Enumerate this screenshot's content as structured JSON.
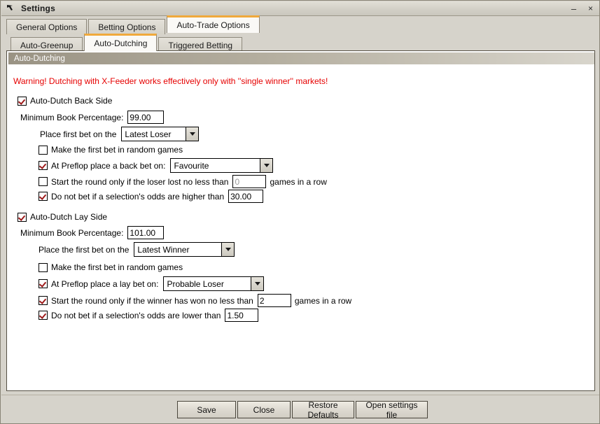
{
  "window": {
    "title": "Settings",
    "icon": "app-arrow-icon",
    "minimize_label": "–",
    "close_label": "×"
  },
  "colors": {
    "warning_text": "#e60000",
    "active_tab_accent": "#f0a93c",
    "dialog_background": "#d6d3cb",
    "panel_background": "#ffffff",
    "checkmark": "#9e1b1b",
    "group_header_text": "#ffffff",
    "disabled_text": "#9a9a9a"
  },
  "tabs_primary": [
    {
      "label": "General Options",
      "active": false
    },
    {
      "label": "Betting Options",
      "active": false
    },
    {
      "label": "Auto-Trade Options",
      "active": true
    }
  ],
  "tabs_secondary": [
    {
      "label": "Auto-Greenup",
      "active": false
    },
    {
      "label": "Auto-Dutching",
      "active": true
    },
    {
      "label": "Triggered Betting",
      "active": false
    }
  ],
  "panel": {
    "group_header": "Auto-Dutching",
    "warning": "Warning! Dutching with X-Feeder works effectively only with ''single winner'' markets!"
  },
  "back_side": {
    "enable_label": "Auto-Dutch Back Side",
    "enable_checked": true,
    "min_book_label": "Minimum Book Percentage:",
    "min_book_value": "99.00",
    "first_bet_label": "Place first bet on the",
    "first_bet_value": "Latest Loser",
    "first_bet_options": [
      "Latest Loser"
    ],
    "random_games_label": "Make the first bet in random games",
    "random_games_checked": false,
    "preflop_label": "At Preflop place a back bet on:",
    "preflop_checked": true,
    "preflop_value": "Favourite",
    "preflop_options": [
      "Favourite"
    ],
    "start_round_checked": false,
    "start_round_label": "Start the round only if the loser lost no less than",
    "start_round_value": "0",
    "start_round_value_disabled": true,
    "start_round_suffix": "games in a row",
    "odds_limit_checked": true,
    "odds_limit_label": "Do not bet if a selection's odds are higher than",
    "odds_limit_value": "30.00"
  },
  "lay_side": {
    "enable_label": "Auto-Dutch Lay Side",
    "enable_checked": true,
    "min_book_label": "Minimum Book Percentage:",
    "min_book_value": "101.00",
    "first_bet_label": "Place the first bet on the",
    "first_bet_value": "Latest Winner",
    "first_bet_options": [
      "Latest Winner"
    ],
    "random_games_label": "Make the first bet in random games",
    "random_games_checked": false,
    "preflop_label": "At Preflop place a lay bet on:",
    "preflop_checked": true,
    "preflop_value": "Probable Loser",
    "preflop_options": [
      "Probable Loser"
    ],
    "start_round_checked": true,
    "start_round_label": "Start the round only if the winner has won no less than",
    "start_round_value": "2",
    "start_round_value_disabled": false,
    "start_round_suffix": "games in a row",
    "odds_limit_checked": true,
    "odds_limit_label": "Do not bet if a selection's odds are lower than",
    "odds_limit_value": "1.50"
  },
  "buttons": [
    {
      "label": "Save"
    },
    {
      "label": "Close"
    },
    {
      "label": "Restore Defaults"
    },
    {
      "label": "Open settings file"
    }
  ]
}
